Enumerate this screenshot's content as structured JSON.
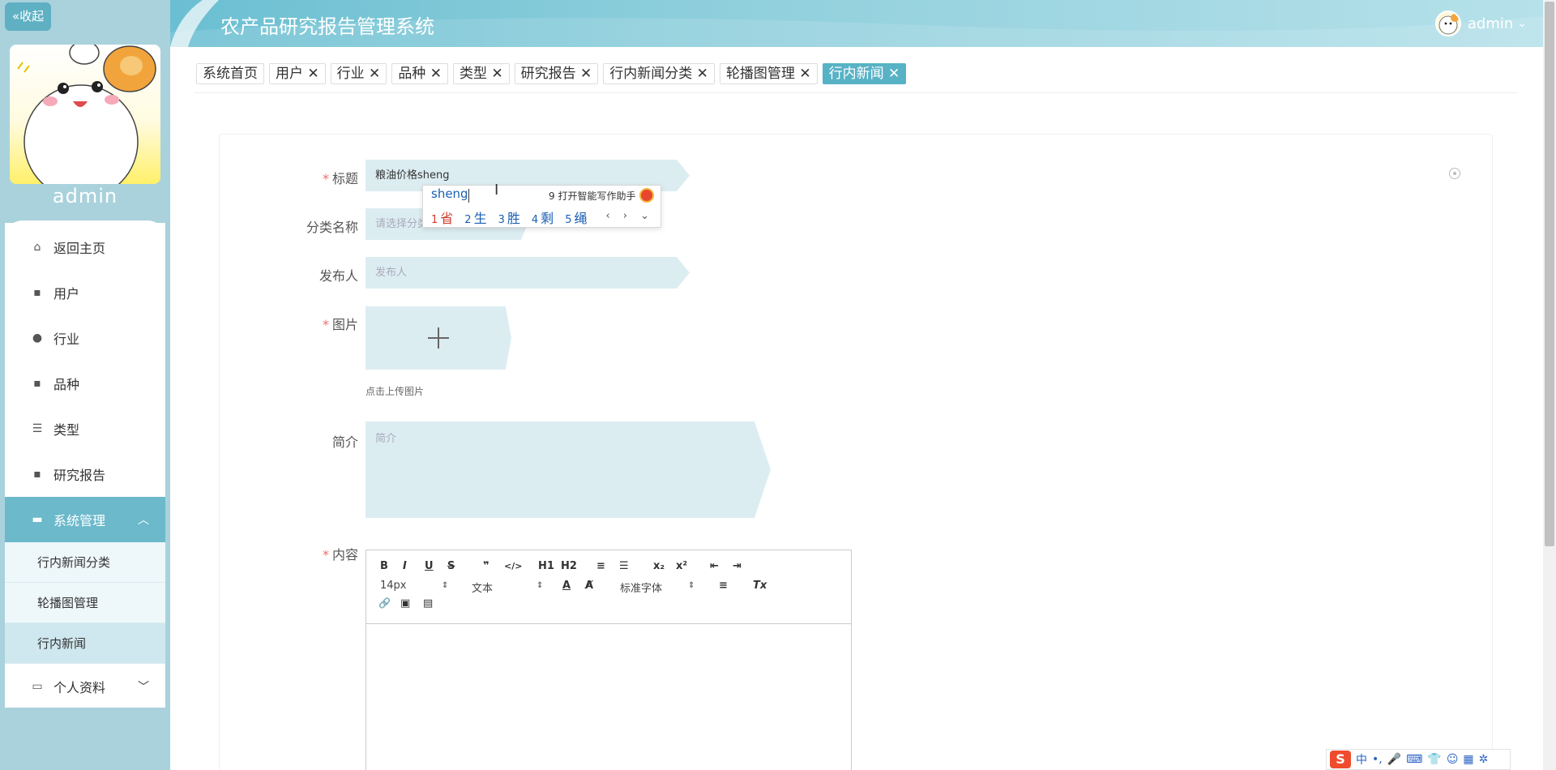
{
  "sidebar": {
    "collapse_label": "«收起",
    "user_name": "admin",
    "menu": [
      {
        "label": "返回主页",
        "icon": "home-icon",
        "glyph": "⌂"
      },
      {
        "label": "用户",
        "icon": "grid-icon",
        "glyph": "▪"
      },
      {
        "label": "行业",
        "icon": "person-icon",
        "glyph": "●"
      },
      {
        "label": "品种",
        "icon": "grid-icon",
        "glyph": "▪"
      },
      {
        "label": "类型",
        "icon": "sliders-icon",
        "glyph": "☰"
      },
      {
        "label": "研究报告",
        "icon": "grid-icon",
        "glyph": "▪"
      },
      {
        "label": "系统管理",
        "icon": "briefcase-icon",
        "glyph": "▬",
        "arrow": "︿"
      },
      {
        "label": "个人资料",
        "icon": "profile-card-icon",
        "glyph": "▭",
        "arrow": "﹀"
      }
    ],
    "submenu": [
      "行内新闻分类",
      "轮播图管理",
      "行内新闻"
    ]
  },
  "header": {
    "title": "农产品研究报告管理系统",
    "user": "admin",
    "caret": "⌄",
    "accent": "#6bbfd2"
  },
  "tabs": [
    {
      "label": "系统首页"
    },
    {
      "label": "用户 ✕"
    },
    {
      "label": "行业 ✕"
    },
    {
      "label": "品种 ✕"
    },
    {
      "label": "类型 ✕"
    },
    {
      "label": "研究报告 ✕"
    },
    {
      "label": "行内新闻分类 ✕"
    },
    {
      "label": "轮播图管理 ✕"
    },
    {
      "label": "行内新闻 ✕"
    }
  ],
  "form": {
    "title_label": "标题",
    "title_value": "粮油价格sheng",
    "category_label": "分类名称",
    "category_placeholder": "请选择分类",
    "publisher_label": "发布人",
    "publisher_placeholder": "发布人",
    "image_label": "图片",
    "upload_tip": "点击上传图片",
    "intro_label": "简介",
    "intro_placeholder": "简介",
    "content_label": "内容",
    "required_mark": "*"
  },
  "editor": {
    "font_size": "14px",
    "header_select": "文本",
    "font_family": "标准字体",
    "buttons": [
      "B",
      "I",
      "U",
      "S",
      "❞",
      "</>",
      "H1",
      "H2",
      "≡",
      "☰",
      "x₂",
      "x²",
      "⇤",
      "⇥",
      "A",
      "A̸",
      "≡",
      "Tx",
      "🔗",
      "▣",
      "▤"
    ]
  },
  "ime": {
    "pinyin": "sheng",
    "assistant": "9 打开智能写作助手",
    "candidates": [
      {
        "n": "1",
        "c": "省"
      },
      {
        "n": "2",
        "c": "生"
      },
      {
        "n": "3",
        "c": "胜"
      },
      {
        "n": "4",
        "c": "剩"
      },
      {
        "n": "5",
        "c": "绳"
      }
    ],
    "nav": "‹ › ⌄"
  },
  "tray": {
    "logo": "S",
    "items": [
      "中",
      "•,",
      "🎤",
      "⌨",
      "👕",
      "☺",
      "▦",
      "✲"
    ]
  }
}
